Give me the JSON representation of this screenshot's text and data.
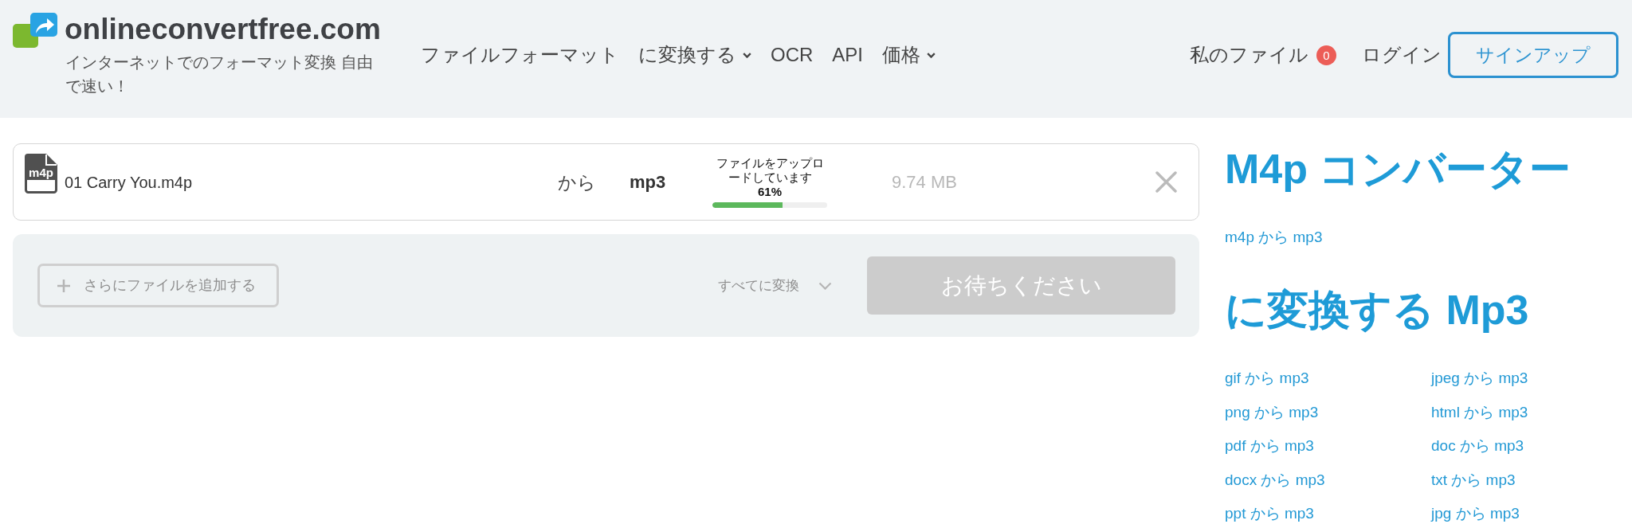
{
  "header": {
    "logo": {
      "name": "onlineconvertfree.com",
      "tagline": "インターネットでのフォーマット変換 自由で速い！"
    },
    "nav": [
      {
        "label": "ファイルフォーマット",
        "dropdown": false
      },
      {
        "label": "に変換する",
        "dropdown": true
      },
      {
        "label": "OCR",
        "dropdown": false
      },
      {
        "label": "API",
        "dropdown": false
      },
      {
        "label": "価格",
        "dropdown": true
      }
    ],
    "my_files": {
      "label": "私のファイル",
      "count": "0"
    },
    "login": "ログイン",
    "signup": "サインアップ"
  },
  "upload": {
    "file_type": "m4p",
    "file_name": "01 Carry You.m4p",
    "from": "から",
    "target_format": "mp3",
    "status": "ファイルをアップロードしています",
    "percent": "61%",
    "level": 0.61,
    "size": "9.74 MB"
  },
  "actions": {
    "add_files": "さらにファイルを追加する",
    "convert_all": "すべてに変換",
    "wait_button": {
      "label": "お待ちください",
      "disabled": true
    }
  },
  "sidebar": {
    "converter_title": "M4p コンバーター",
    "converter_links": [
      "m4p から mp3"
    ],
    "convert_to_title": "に変換する Mp3",
    "convert_to_links": [
      "gif から mp3",
      "jpeg から mp3",
      "png から mp3",
      "html から mp3",
      "pdf から mp3",
      "doc から mp3",
      "docx から mp3",
      "txt から mp3",
      "ppt から mp3",
      "jpg から mp3"
    ]
  }
}
